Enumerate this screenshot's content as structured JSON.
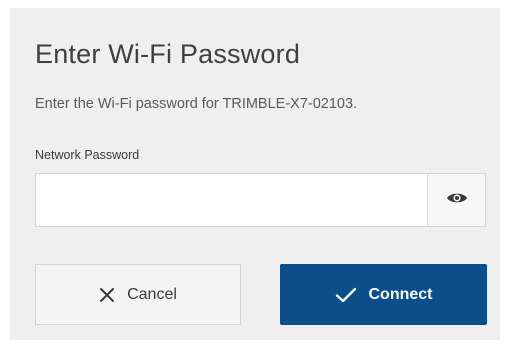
{
  "dialog": {
    "title": "Enter Wi-Fi Password",
    "description": "Enter the Wi-Fi password for TRIMBLE-X7-02103.",
    "password_field": {
      "label": "Network Password",
      "value": "",
      "placeholder": "",
      "toggle_icon": "eye-icon"
    },
    "buttons": {
      "cancel": {
        "label": "Cancel",
        "icon": "close-icon"
      },
      "connect": {
        "label": "Connect",
        "icon": "checkmark-icon"
      }
    }
  },
  "colors": {
    "dialog_background": "#efefef",
    "primary_button": "#0b4f8a",
    "primary_button_text": "#ffffff",
    "secondary_button": "#f4f4f4",
    "text": "#3f3f3f"
  }
}
